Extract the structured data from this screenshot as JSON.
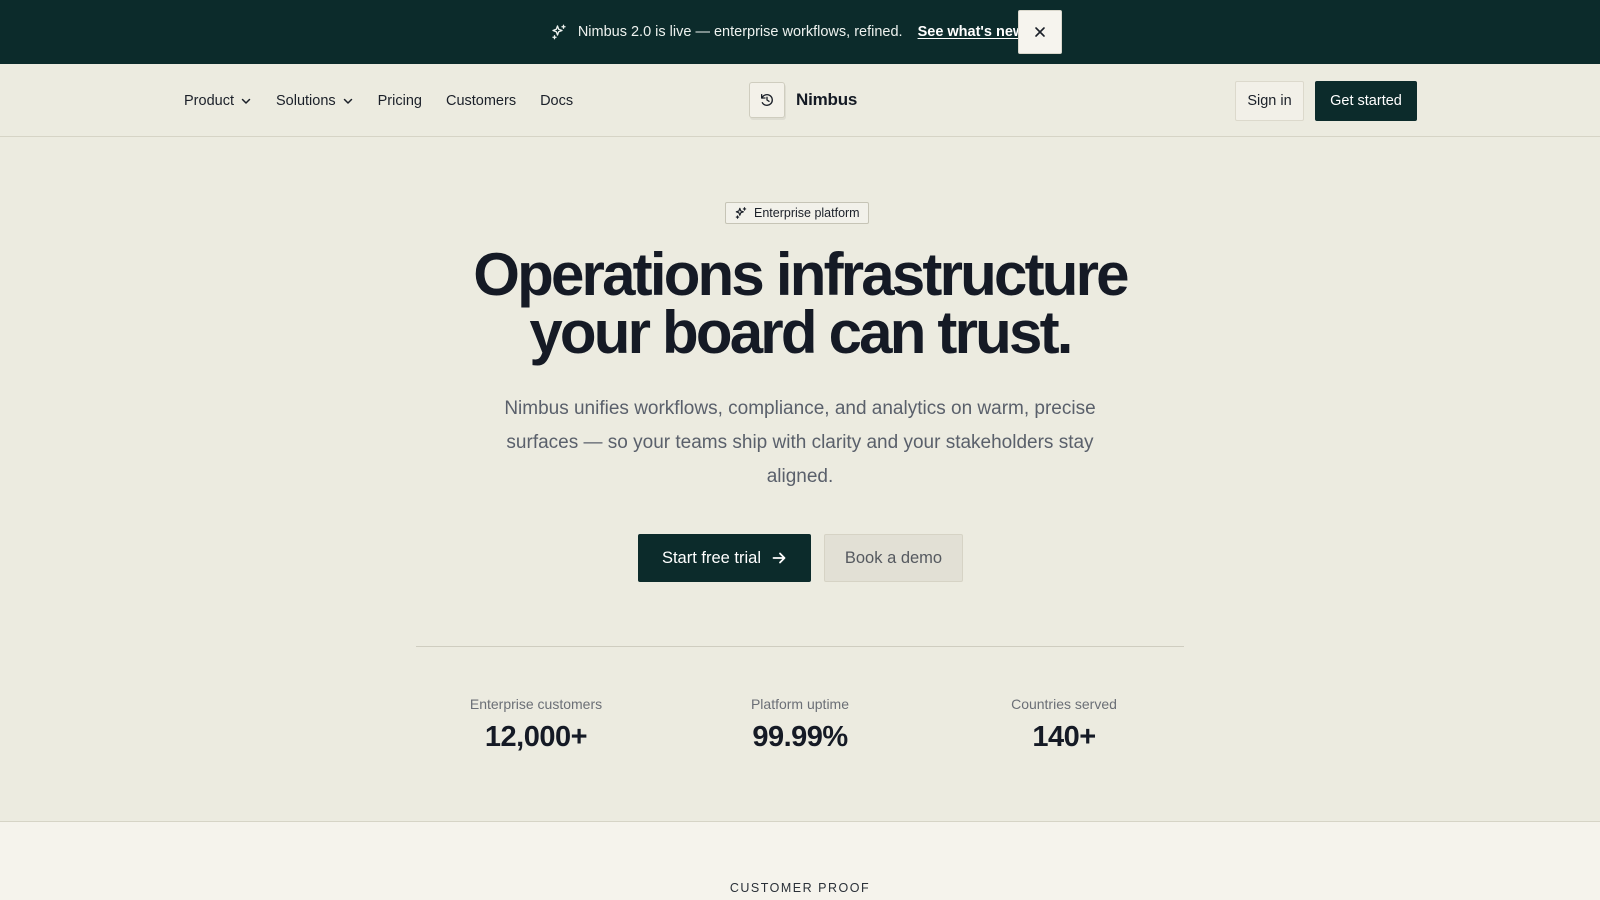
{
  "announcement": {
    "text": "Nimbus 2.0 is live — enterprise workflows, refined.",
    "link": "See what's new",
    "icon": "sparkles-icon",
    "close_icon": "close-icon"
  },
  "nav": {
    "items": [
      {
        "label": "Product",
        "dropdown": true
      },
      {
        "label": "Solutions",
        "dropdown": true
      },
      {
        "label": "Pricing"
      },
      {
        "label": "Customers"
      },
      {
        "label": "Docs"
      }
    ],
    "brand": "Nimbus",
    "brand_icon": "nimbus-logo-icon",
    "sign_in": "Sign in",
    "get_started": "Get started"
  },
  "hero": {
    "badge": "Enterprise platform",
    "headline_line1": "Operations infrastructure",
    "headline_line2": "your board can trust.",
    "subtitle": "Nimbus unifies workflows, compliance, and analytics on warm, precise surfaces — so your teams ship with clarity and your stakeholders stay aligned.",
    "cta_primary": "Start free trial",
    "cta_secondary": "Book a demo"
  },
  "stats": [
    {
      "label": "Enterprise customers",
      "value": "12,000+"
    },
    {
      "label": "Platform uptime",
      "value": "99.99%"
    },
    {
      "label": "Countries served",
      "value": "140+"
    }
  ],
  "section": {
    "eyebrow": "CUSTOMER PROOF"
  },
  "colors": {
    "accent": "#0c2b2b",
    "background": "#ecebe0",
    "text": "#151a25"
  }
}
